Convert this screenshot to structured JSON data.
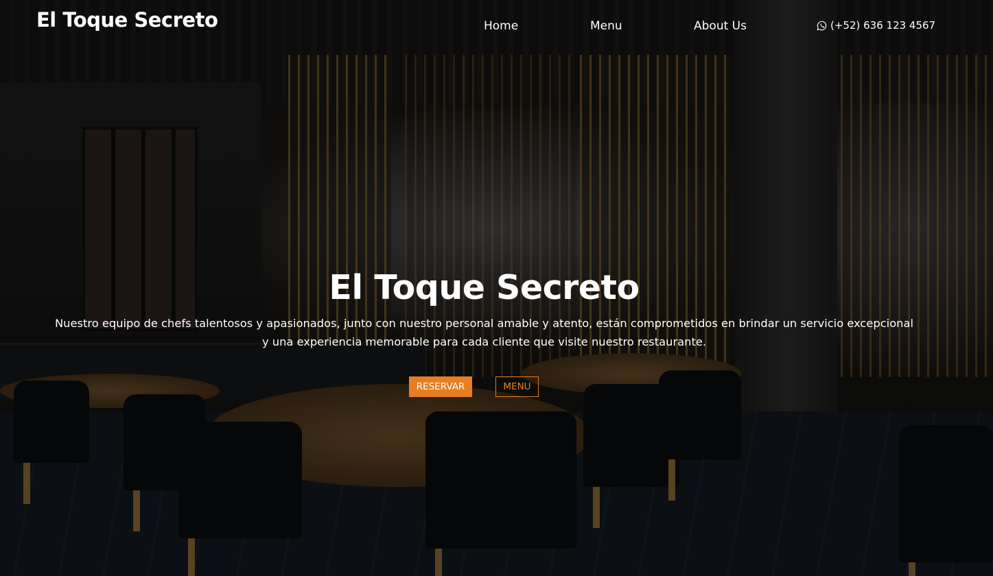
{
  "brand": {
    "name": "El Toque Secreto"
  },
  "nav": {
    "home": "Home",
    "menu": "Menu",
    "about": "About Us"
  },
  "contact": {
    "icon": "whatsapp-icon",
    "phone": "(+52) 636 123 4567"
  },
  "hero": {
    "title": "El Toque Secreto",
    "description": "Nuestro equipo de chefs talentosos y apasionados, junto con nuestro personal amable y atento, están comprometidos en brindar un servicio excepcional y una experiencia memorable para cada cliente que visite nuestro restaurante.",
    "reserve_button": "RESERVAR",
    "menu_button": "MENU"
  },
  "colors": {
    "accent": "#e67e22",
    "text": "#ffffff"
  }
}
